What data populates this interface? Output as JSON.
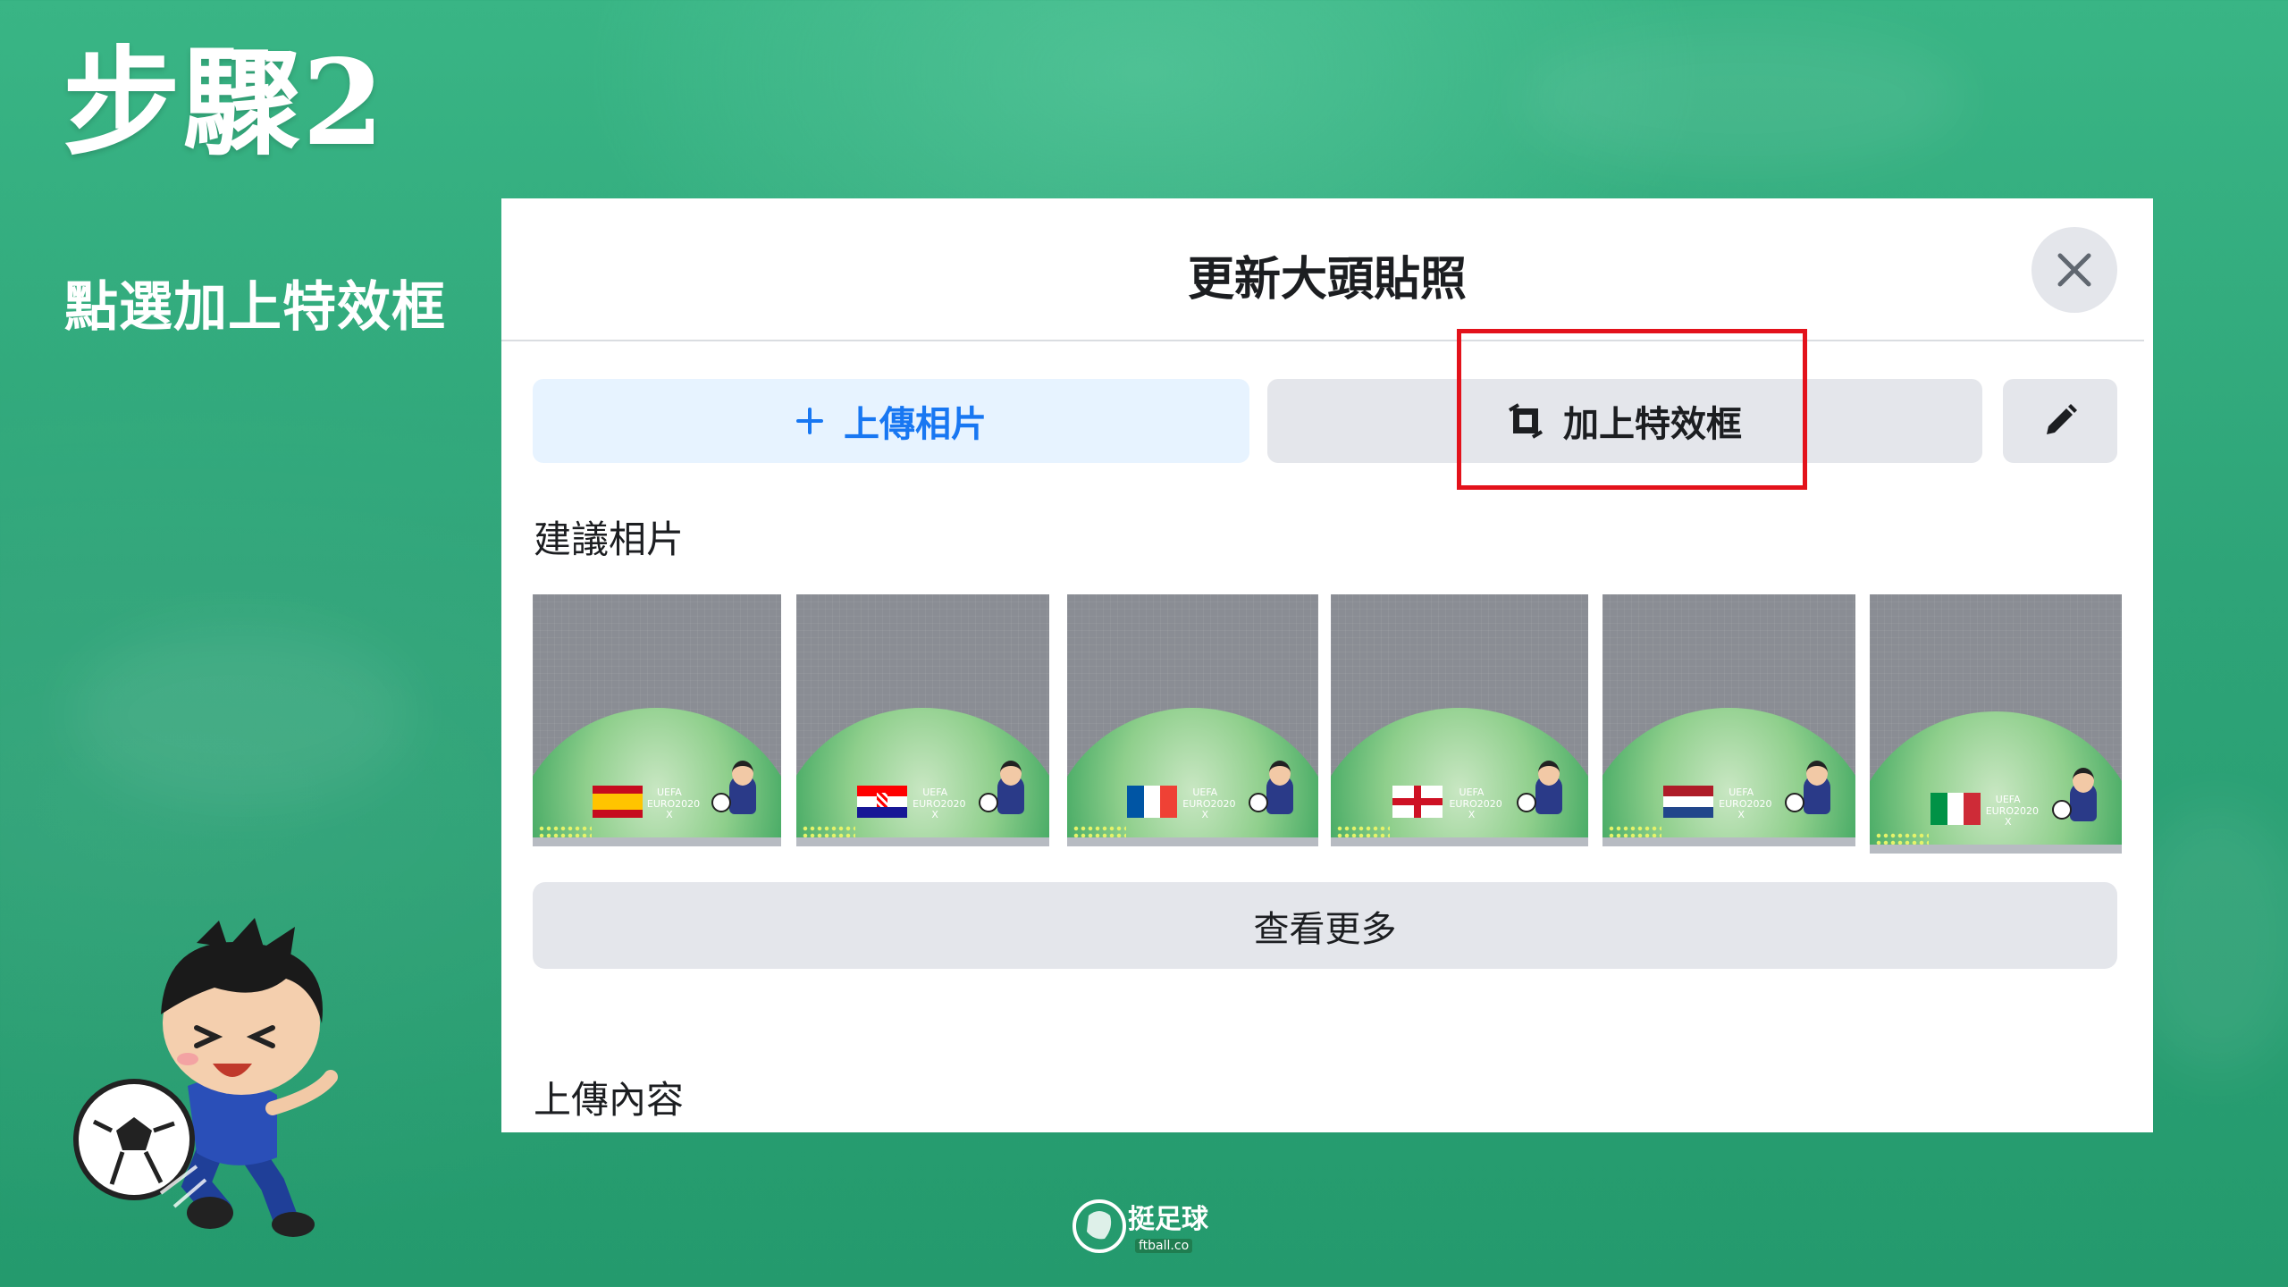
{
  "slide": {
    "step_title": "步驟2",
    "step_subtitle": "點選加上特效框"
  },
  "dialog": {
    "title": "更新大頭貼照",
    "close_icon": "close-icon",
    "buttons": {
      "upload_label": "上傳相片",
      "upload_icon": "plus-icon",
      "frame_label": "加上特效框",
      "frame_icon": "frame-icon",
      "edit_icon": "pencil-icon"
    },
    "suggested_label": "建議相片",
    "suggested_photos": [
      {
        "euro_text": "UEFA EURO2020 X",
        "flag": "spain"
      },
      {
        "euro_text": "UEFA EURO2020 X",
        "flag": "croatia"
      },
      {
        "euro_text": "UEFA EURO2020 X",
        "flag": "france"
      },
      {
        "euro_text": "UEFA EURO2020 X",
        "flag": "england"
      },
      {
        "euro_text": "UEFA EURO2020 X",
        "flag": "netherlands"
      },
      {
        "euro_text": "UEFA EURO2020 X",
        "flag": "italy"
      }
    ],
    "see_more_label": "查看更多",
    "uploads_label": "上傳內容"
  },
  "branding": {
    "logo_text": "挺足球",
    "logo_sub": "ftball.co"
  },
  "colors": {
    "background": "#2ea478",
    "highlight": "#e3121b",
    "upload_button_bg": "#e7f3ff",
    "upload_button_text": "#1877f2",
    "secondary_button_bg": "#e4e6eb"
  }
}
